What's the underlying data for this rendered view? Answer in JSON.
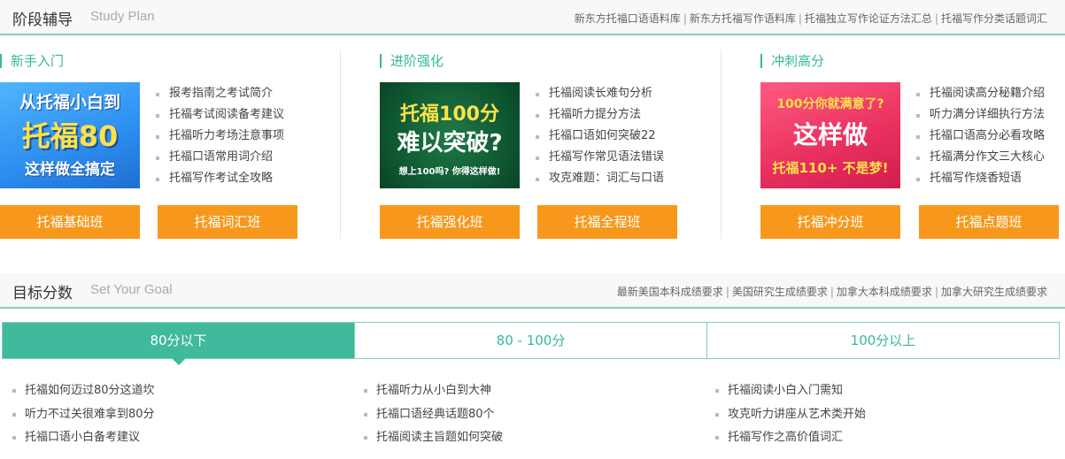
{
  "study_plan": {
    "title": "阶段辅导",
    "subtitle": "Study Plan",
    "links": [
      "新东方托福口语语料库",
      "新东方托福写作语料库",
      "托福独立写作论证方法汇总",
      "托福写作分类话题词汇"
    ],
    "columns": [
      {
        "title": "新手入门",
        "banner": {
          "line1": "从托福小白到",
          "line2": "托福80",
          "line3": "这样做全搞定"
        },
        "items": [
          "报考指南之考试简介",
          "托福考试阅读备考建议",
          "托福听力考场注意事项",
          "托福口语常用词介绍",
          "托福写作考试全攻略"
        ],
        "buttons": [
          "托福基础班",
          "托福词汇班"
        ]
      },
      {
        "title": "进阶强化",
        "banner": {
          "line1": "托福100分",
          "line2": "难以突破?",
          "line3": "想上100吗? 你得这样做!"
        },
        "items": [
          "托福阅读长难句分析",
          "托福听力提分方法",
          "托福口语如何突破22",
          "托福写作常见语法错误",
          "攻克难题：词汇与口语"
        ],
        "buttons": [
          "托福强化班",
          "托福全程班"
        ]
      },
      {
        "title": "冲刺高分",
        "banner": {
          "line1": "100分你就满意了?",
          "line2": "这样做",
          "line3": "托福110+ 不是梦!"
        },
        "items": [
          "托福阅读高分秘籍介绍",
          "听力满分详细执行方法",
          "托福口语高分必看攻略",
          "托福满分作文三大核心",
          "托福写作烧香短语"
        ],
        "buttons": [
          "托福冲分班",
          "托福点题班"
        ]
      }
    ]
  },
  "goal": {
    "title": "目标分数",
    "subtitle": "Set Your Goal",
    "links": [
      "最新美国本科成绩要求",
      "美国研究生成绩要求",
      "加拿大本科成绩要求",
      "加拿大研究生成绩要求"
    ],
    "tabs": [
      "80分以下",
      "80 - 100分",
      "100分以上"
    ],
    "active_tab": "80分以下",
    "lists": [
      [
        "托福如何迈过80分这道坎",
        "听力不过关很难拿到80分",
        "托福口语小白备考建议"
      ],
      [
        "托福听力从小白到大神",
        "托福口语经典话题80个",
        "托福阅读主旨题如何突破"
      ],
      [
        "托福阅读小白入门需知",
        "攻克听力讲座从艺术类开始",
        "托福写作之高价值词汇"
      ]
    ]
  },
  "colors": {
    "accent": "#36b89a",
    "button": "#f7981c",
    "tab_active": "#40b99c"
  }
}
